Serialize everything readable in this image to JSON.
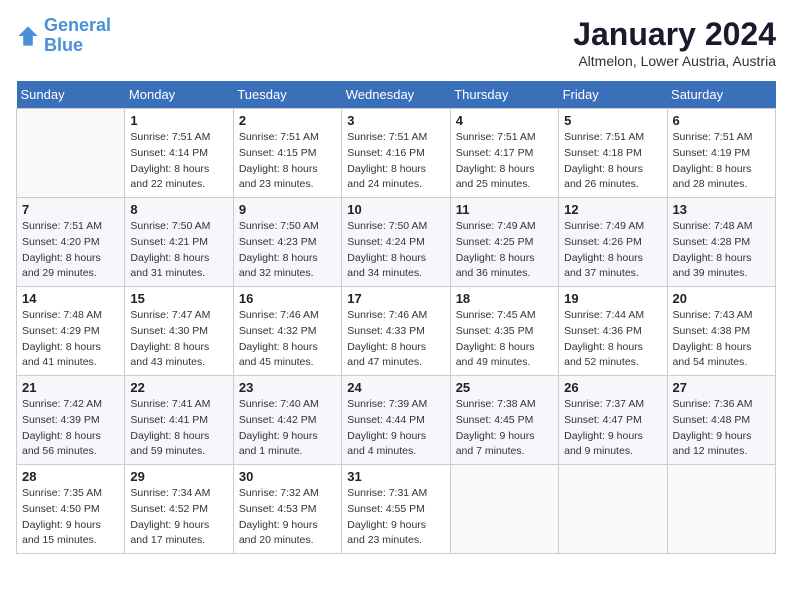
{
  "header": {
    "logo_line1": "General",
    "logo_line2": "Blue",
    "month_year": "January 2024",
    "location": "Altmelon, Lower Austria, Austria"
  },
  "days_of_week": [
    "Sunday",
    "Monday",
    "Tuesday",
    "Wednesday",
    "Thursday",
    "Friday",
    "Saturday"
  ],
  "weeks": [
    [
      {
        "day": "",
        "sunrise": "",
        "sunset": "",
        "daylight": ""
      },
      {
        "day": "1",
        "sunrise": "Sunrise: 7:51 AM",
        "sunset": "Sunset: 4:14 PM",
        "daylight": "Daylight: 8 hours and 22 minutes."
      },
      {
        "day": "2",
        "sunrise": "Sunrise: 7:51 AM",
        "sunset": "Sunset: 4:15 PM",
        "daylight": "Daylight: 8 hours and 23 minutes."
      },
      {
        "day": "3",
        "sunrise": "Sunrise: 7:51 AM",
        "sunset": "Sunset: 4:16 PM",
        "daylight": "Daylight: 8 hours and 24 minutes."
      },
      {
        "day": "4",
        "sunrise": "Sunrise: 7:51 AM",
        "sunset": "Sunset: 4:17 PM",
        "daylight": "Daylight: 8 hours and 25 minutes."
      },
      {
        "day": "5",
        "sunrise": "Sunrise: 7:51 AM",
        "sunset": "Sunset: 4:18 PM",
        "daylight": "Daylight: 8 hours and 26 minutes."
      },
      {
        "day": "6",
        "sunrise": "Sunrise: 7:51 AM",
        "sunset": "Sunset: 4:19 PM",
        "daylight": "Daylight: 8 hours and 28 minutes."
      }
    ],
    [
      {
        "day": "7",
        "sunrise": "Sunrise: 7:51 AM",
        "sunset": "Sunset: 4:20 PM",
        "daylight": "Daylight: 8 hours and 29 minutes."
      },
      {
        "day": "8",
        "sunrise": "Sunrise: 7:50 AM",
        "sunset": "Sunset: 4:21 PM",
        "daylight": "Daylight: 8 hours and 31 minutes."
      },
      {
        "day": "9",
        "sunrise": "Sunrise: 7:50 AM",
        "sunset": "Sunset: 4:23 PM",
        "daylight": "Daylight: 8 hours and 32 minutes."
      },
      {
        "day": "10",
        "sunrise": "Sunrise: 7:50 AM",
        "sunset": "Sunset: 4:24 PM",
        "daylight": "Daylight: 8 hours and 34 minutes."
      },
      {
        "day": "11",
        "sunrise": "Sunrise: 7:49 AM",
        "sunset": "Sunset: 4:25 PM",
        "daylight": "Daylight: 8 hours and 36 minutes."
      },
      {
        "day": "12",
        "sunrise": "Sunrise: 7:49 AM",
        "sunset": "Sunset: 4:26 PM",
        "daylight": "Daylight: 8 hours and 37 minutes."
      },
      {
        "day": "13",
        "sunrise": "Sunrise: 7:48 AM",
        "sunset": "Sunset: 4:28 PM",
        "daylight": "Daylight: 8 hours and 39 minutes."
      }
    ],
    [
      {
        "day": "14",
        "sunrise": "Sunrise: 7:48 AM",
        "sunset": "Sunset: 4:29 PM",
        "daylight": "Daylight: 8 hours and 41 minutes."
      },
      {
        "day": "15",
        "sunrise": "Sunrise: 7:47 AM",
        "sunset": "Sunset: 4:30 PM",
        "daylight": "Daylight: 8 hours and 43 minutes."
      },
      {
        "day": "16",
        "sunrise": "Sunrise: 7:46 AM",
        "sunset": "Sunset: 4:32 PM",
        "daylight": "Daylight: 8 hours and 45 minutes."
      },
      {
        "day": "17",
        "sunrise": "Sunrise: 7:46 AM",
        "sunset": "Sunset: 4:33 PM",
        "daylight": "Daylight: 8 hours and 47 minutes."
      },
      {
        "day": "18",
        "sunrise": "Sunrise: 7:45 AM",
        "sunset": "Sunset: 4:35 PM",
        "daylight": "Daylight: 8 hours and 49 minutes."
      },
      {
        "day": "19",
        "sunrise": "Sunrise: 7:44 AM",
        "sunset": "Sunset: 4:36 PM",
        "daylight": "Daylight: 8 hours and 52 minutes."
      },
      {
        "day": "20",
        "sunrise": "Sunrise: 7:43 AM",
        "sunset": "Sunset: 4:38 PM",
        "daylight": "Daylight: 8 hours and 54 minutes."
      }
    ],
    [
      {
        "day": "21",
        "sunrise": "Sunrise: 7:42 AM",
        "sunset": "Sunset: 4:39 PM",
        "daylight": "Daylight: 8 hours and 56 minutes."
      },
      {
        "day": "22",
        "sunrise": "Sunrise: 7:41 AM",
        "sunset": "Sunset: 4:41 PM",
        "daylight": "Daylight: 8 hours and 59 minutes."
      },
      {
        "day": "23",
        "sunrise": "Sunrise: 7:40 AM",
        "sunset": "Sunset: 4:42 PM",
        "daylight": "Daylight: 9 hours and 1 minute."
      },
      {
        "day": "24",
        "sunrise": "Sunrise: 7:39 AM",
        "sunset": "Sunset: 4:44 PM",
        "daylight": "Daylight: 9 hours and 4 minutes."
      },
      {
        "day": "25",
        "sunrise": "Sunrise: 7:38 AM",
        "sunset": "Sunset: 4:45 PM",
        "daylight": "Daylight: 9 hours and 7 minutes."
      },
      {
        "day": "26",
        "sunrise": "Sunrise: 7:37 AM",
        "sunset": "Sunset: 4:47 PM",
        "daylight": "Daylight: 9 hours and 9 minutes."
      },
      {
        "day": "27",
        "sunrise": "Sunrise: 7:36 AM",
        "sunset": "Sunset: 4:48 PM",
        "daylight": "Daylight: 9 hours and 12 minutes."
      }
    ],
    [
      {
        "day": "28",
        "sunrise": "Sunrise: 7:35 AM",
        "sunset": "Sunset: 4:50 PM",
        "daylight": "Daylight: 9 hours and 15 minutes."
      },
      {
        "day": "29",
        "sunrise": "Sunrise: 7:34 AM",
        "sunset": "Sunset: 4:52 PM",
        "daylight": "Daylight: 9 hours and 17 minutes."
      },
      {
        "day": "30",
        "sunrise": "Sunrise: 7:32 AM",
        "sunset": "Sunset: 4:53 PM",
        "daylight": "Daylight: 9 hours and 20 minutes."
      },
      {
        "day": "31",
        "sunrise": "Sunrise: 7:31 AM",
        "sunset": "Sunset: 4:55 PM",
        "daylight": "Daylight: 9 hours and 23 minutes."
      },
      {
        "day": "",
        "sunrise": "",
        "sunset": "",
        "daylight": ""
      },
      {
        "day": "",
        "sunrise": "",
        "sunset": "",
        "daylight": ""
      },
      {
        "day": "",
        "sunrise": "",
        "sunset": "",
        "daylight": ""
      }
    ]
  ]
}
